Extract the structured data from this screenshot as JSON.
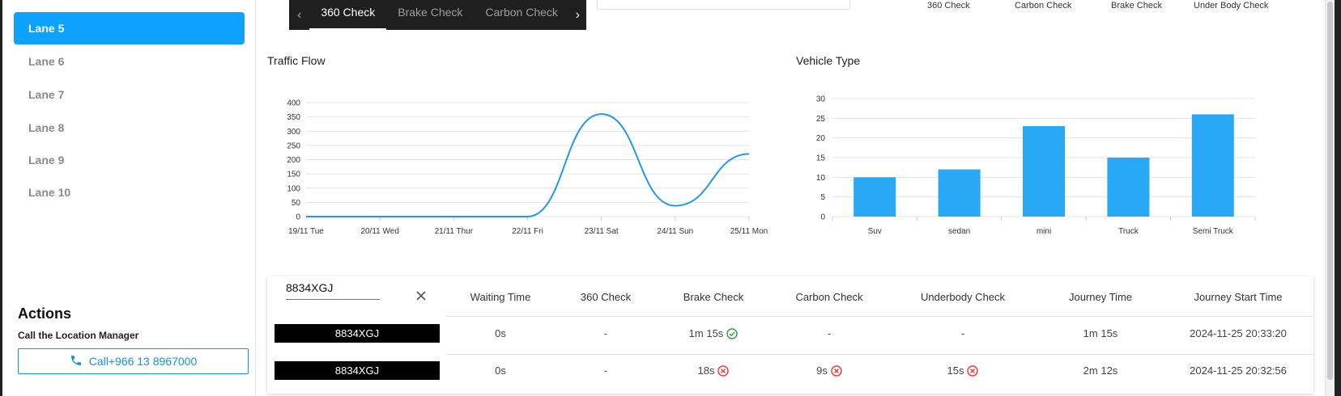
{
  "sidebar": {
    "lanes": [
      {
        "label": "Lane 5",
        "active": true
      },
      {
        "label": "Lane 6",
        "active": false
      },
      {
        "label": "Lane 7",
        "active": false
      },
      {
        "label": "Lane 8",
        "active": false
      },
      {
        "label": "Lane 9",
        "active": false
      },
      {
        "label": "Lane 10",
        "active": false
      }
    ],
    "actions_title": "Actions",
    "actions_subtitle": "Call the Location Manager",
    "call_button": "Call+966 13 8967000"
  },
  "tabs": [
    {
      "label": "360 Check",
      "active": true
    },
    {
      "label": "Brake Check",
      "active": false
    },
    {
      "label": "Carbon Check",
      "active": false
    }
  ],
  "top_legend": [
    "360 Check",
    "Carbon Check",
    "Brake Check",
    "Under Body Check"
  ],
  "traffic_chart": {
    "title": "Traffic Flow",
    "chart_data": {
      "type": "line",
      "x": [
        "19/11 Tue",
        "20/11 Wed",
        "21/11 Thur",
        "22/11 Fri",
        "23/11 Sat",
        "24/11 Sun",
        "25/11 Mon"
      ],
      "values": [
        0,
        0,
        0,
        0,
        360,
        38,
        220
      ],
      "yticks": [
        0,
        50,
        100,
        150,
        200,
        250,
        300,
        350,
        400
      ],
      "ylim": [
        0,
        400
      ],
      "grid": true,
      "color": "#2196f3"
    }
  },
  "vehicle_chart": {
    "title": "Vehicle Type",
    "chart_data": {
      "type": "bar",
      "categories": [
        "Suv",
        "sedan",
        "mini",
        "Truck",
        "Semi Truck"
      ],
      "values": [
        10,
        12,
        23,
        15,
        26
      ],
      "yticks": [
        0,
        5,
        10,
        15,
        20,
        25,
        30
      ],
      "ylim": [
        0,
        30
      ],
      "grid": true,
      "color": "#29a8f5"
    }
  },
  "table": {
    "search_value": "8834XGJ",
    "headers": [
      "Waiting Time",
      "360 Check",
      "Brake Check",
      "Carbon Check",
      "Underbody Check",
      "Journey Time",
      "Journey Start Time"
    ],
    "rows": [
      {
        "plate": "8834XGJ",
        "waiting": "0s",
        "c360": "-",
        "brake": "1m 15s",
        "brake_status": "ok",
        "carbon": "-",
        "carbon_status": "",
        "underbody": "-",
        "underbody_status": "",
        "journey": "1m 15s",
        "start": "2024-11-25 20:33:20"
      },
      {
        "plate": "8834XGJ",
        "waiting": "0s",
        "c360": "-",
        "brake": "18s",
        "brake_status": "fail",
        "carbon": "9s",
        "carbon_status": "fail",
        "underbody": "15s",
        "underbody_status": "fail",
        "journey": "2m 12s",
        "start": "2024-11-25 20:32:56"
      }
    ]
  },
  "colors": {
    "accent": "#0da2ff",
    "ok": "#2e9e3e",
    "fail": "#e53935",
    "line": "#2196f3",
    "bar": "#29a8f5"
  }
}
